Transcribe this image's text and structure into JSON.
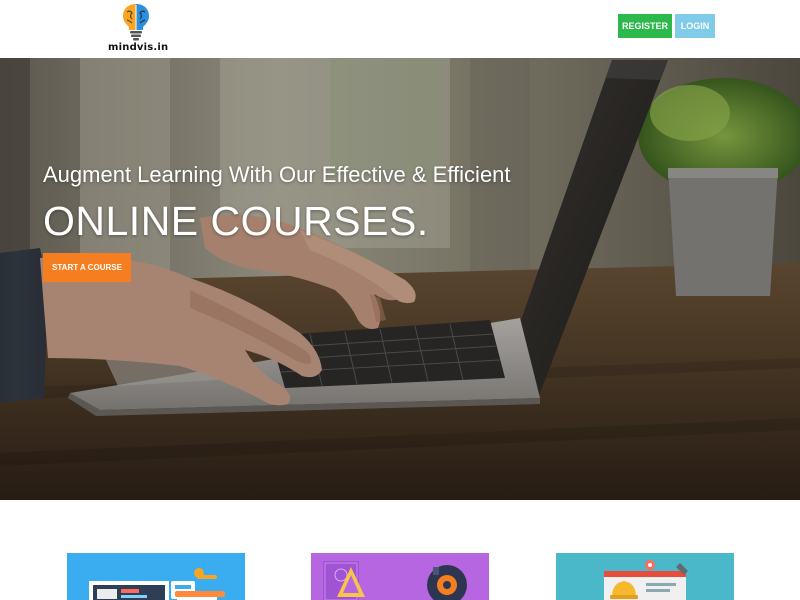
{
  "header": {
    "logo_text": "mindvis.in",
    "register_label": "REGISTER",
    "login_label": "LOGIN"
  },
  "hero": {
    "tagline": "Augment Learning With Our Effective & Efficient",
    "headline": "ONLINE COURSES.",
    "cta_label": "START A COURSE"
  },
  "colors": {
    "register_bg": "#2db84b",
    "login_bg": "#7ecbea",
    "cta_bg": "#f57f20",
    "card1_bg": "#3aacf0",
    "card2_bg": "#b566e0",
    "card3_bg": "#4ab8c8"
  },
  "icons": {
    "logo": "brain-lightbulb-icon",
    "card1": "presentation-screen-icon",
    "card2": "design-tools-icon",
    "card3": "engineering-helmet-icon"
  }
}
